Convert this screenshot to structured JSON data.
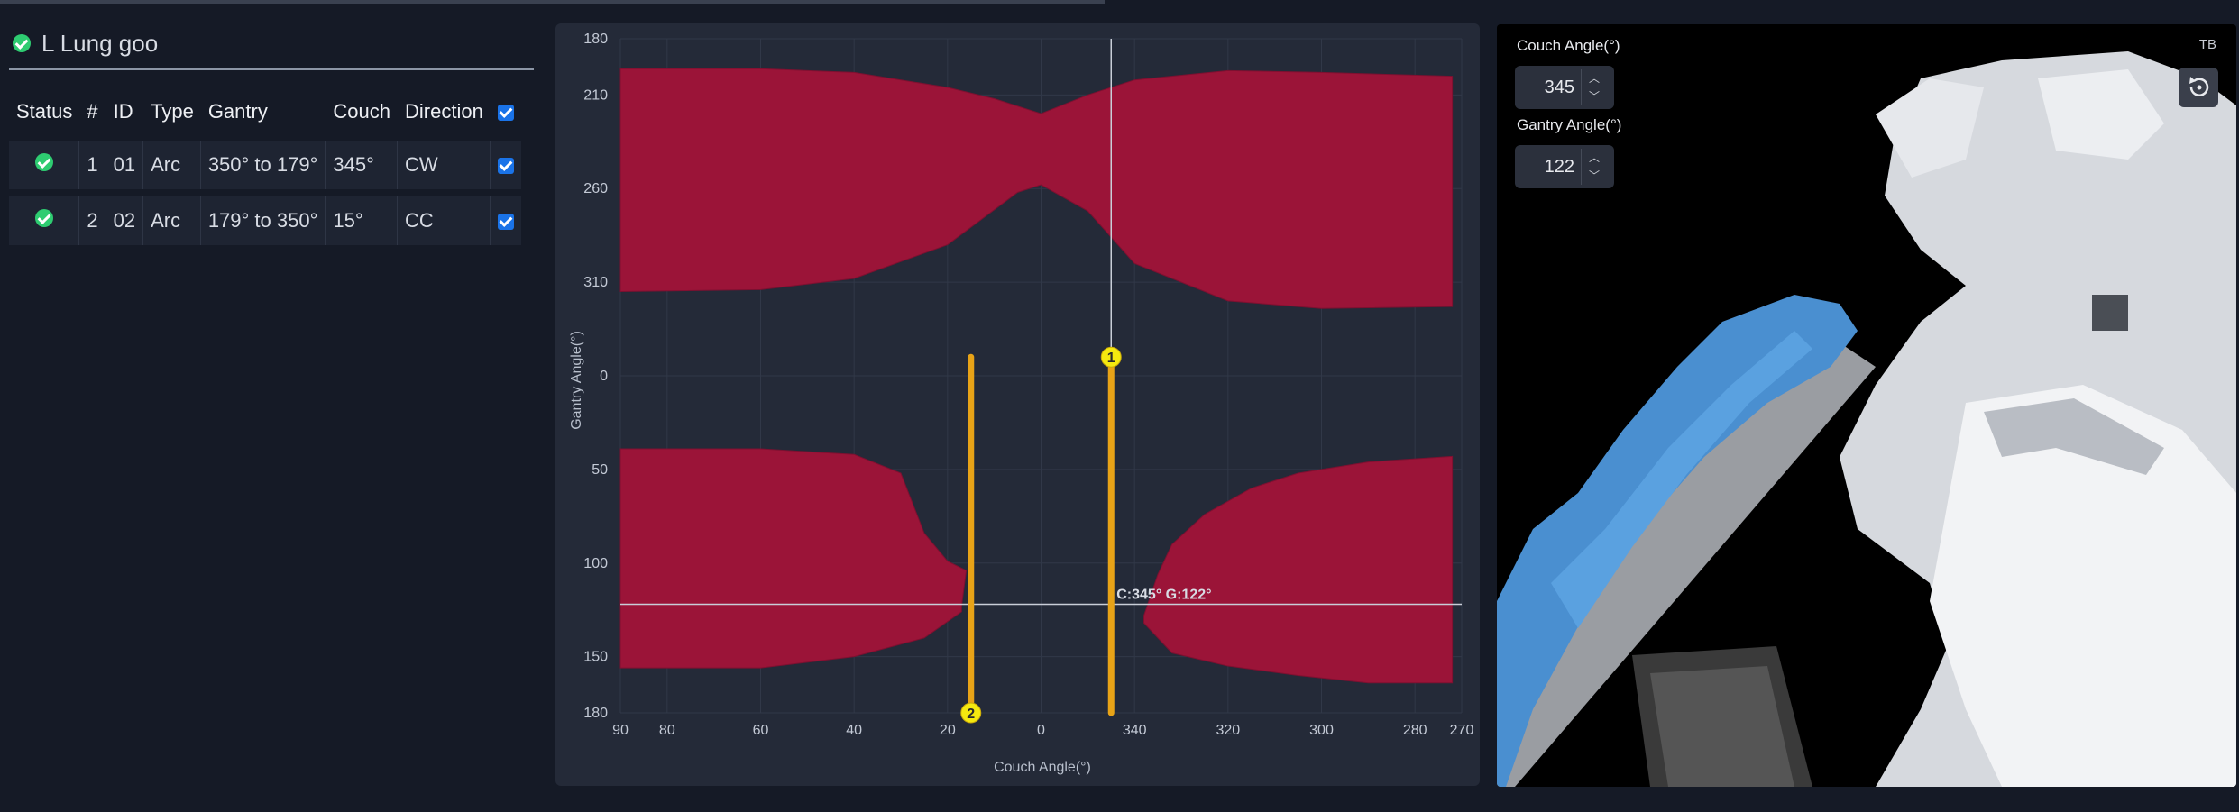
{
  "plan": {
    "name": "L Lung goo"
  },
  "table": {
    "headers": [
      "Status",
      "#",
      "ID",
      "Type",
      "Gantry",
      "Couch",
      "Direction"
    ],
    "rows": [
      {
        "num": "1",
        "id": "01",
        "type": "Arc",
        "gantry": "350° to 179°",
        "couch": "345°",
        "direction": "CW"
      },
      {
        "num": "2",
        "id": "02",
        "type": "Arc",
        "gantry": "179° to 350°",
        "couch": "15°",
        "direction": "CC"
      }
    ]
  },
  "chart_data": {
    "type": "scatter",
    "xlabel": "Couch Angle(°)",
    "ylabel": "Gantry Angle(°)",
    "x_ticks": [
      "90",
      "80",
      "60",
      "40",
      "20",
      "0",
      "340",
      "320",
      "300",
      "280",
      "270"
    ],
    "y_ticks": [
      "180",
      "210",
      "260",
      "310",
      "0",
      "50",
      "100",
      "150",
      "180"
    ],
    "x_range": [
      90,
      -90
    ],
    "y_range": [
      -180,
      180
    ],
    "grid": true,
    "collision_color": "#9b1438",
    "beam_color": "#e8a317",
    "crosshair": {
      "couch": -15,
      "gantry": 122,
      "label": "C:345° G:122°"
    },
    "beams": [
      {
        "label": "1",
        "couch": -15,
        "gantry_start": -10,
        "gantry_end": 180
      },
      {
        "label": "2",
        "couch": 15,
        "gantry_start": -10,
        "gantry_end": 180
      }
    ],
    "collision_regions": [
      {
        "name": "upper",
        "upper_boundary": [
          [
            90,
            -164
          ],
          [
            60,
            -164
          ],
          [
            40,
            -162
          ],
          [
            20,
            -154
          ],
          [
            10,
            -148
          ],
          [
            0,
            -140
          ],
          [
            -10,
            -150
          ],
          [
            -20,
            -158
          ],
          [
            -40,
            -163
          ],
          [
            -60,
            -162
          ],
          [
            -88,
            -160
          ]
        ],
        "lower_boundary": [
          [
            90,
            -45
          ],
          [
            60,
            -46
          ],
          [
            40,
            -52
          ],
          [
            20,
            -70
          ],
          [
            5,
            -98
          ],
          [
            0,
            -102
          ],
          [
            -10,
            -88
          ],
          [
            -20,
            -60
          ],
          [
            -40,
            -40
          ],
          [
            -60,
            -36
          ],
          [
            -88,
            -37
          ]
        ]
      },
      {
        "name": "lower",
        "upper_boundary": [
          [
            90,
            39
          ],
          [
            60,
            39
          ],
          [
            40,
            42
          ],
          [
            30,
            52
          ],
          [
            25,
            84
          ],
          [
            20,
            99
          ],
          [
            16,
            104
          ],
          [
            17,
            123
          ]
        ],
        "lower_boundary": [
          [
            90,
            156
          ],
          [
            60,
            156
          ],
          [
            40,
            150
          ],
          [
            25,
            140
          ],
          [
            17,
            126
          ]
        ]
      },
      {
        "name": "lower-right",
        "upper_boundary": [
          [
            -88,
            43
          ],
          [
            -70,
            46
          ],
          [
            -55,
            52
          ],
          [
            -45,
            60
          ],
          [
            -35,
            74
          ],
          [
            -28,
            90
          ],
          [
            -25,
            106
          ],
          [
            -22,
            128
          ]
        ],
        "lower_boundary": [
          [
            -88,
            164
          ],
          [
            -70,
            164
          ],
          [
            -55,
            160
          ],
          [
            -40,
            155
          ],
          [
            -28,
            148
          ],
          [
            -22,
            132
          ]
        ]
      }
    ]
  },
  "view3d": {
    "couch_label": "Couch Angle(°)",
    "couch_value": "345",
    "gantry_label": "Gantry Angle(°)",
    "gantry_value": "122",
    "corner_tag": "TB"
  }
}
